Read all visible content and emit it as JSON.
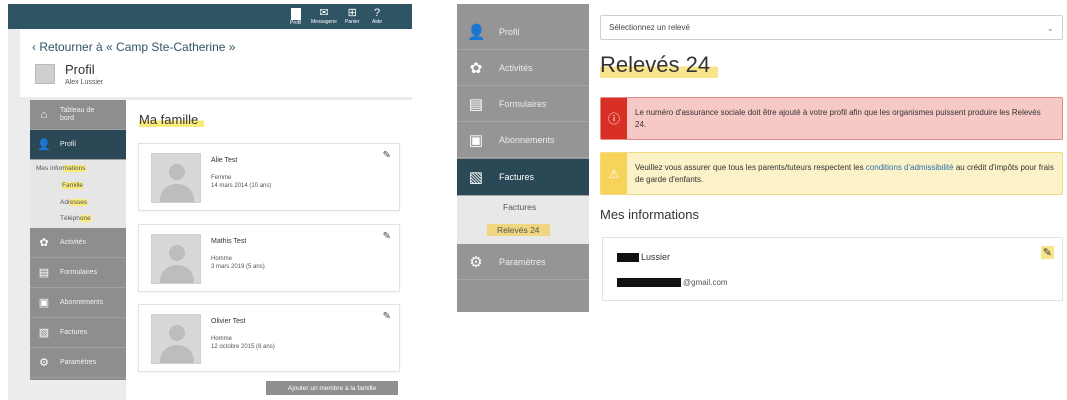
{
  "left": {
    "topbar": {
      "items": [
        {
          "label": "Profil",
          "icon": "profile-icon"
        },
        {
          "label": "Messagerie",
          "icon": "mail-icon"
        },
        {
          "label": "Panier",
          "icon": "cart-icon"
        },
        {
          "label": "Aide",
          "icon": "help-icon"
        }
      ]
    },
    "back_link": "‹  Retourner à « Camp Ste-Catherine »",
    "profile": {
      "title": "Profil",
      "name": "Alex Lussier"
    },
    "sidebar": {
      "items": [
        {
          "label": "Tableau de bord",
          "icon": "home-icon"
        },
        {
          "label": "Profil",
          "icon": "person-icon"
        },
        {
          "label": "Activités",
          "icon": "activities-icon"
        },
        {
          "label": "Formulaires",
          "icon": "forms-icon"
        },
        {
          "label": "Abonnements",
          "icon": "card-icon"
        },
        {
          "label": "Factures",
          "icon": "invoice-icon"
        },
        {
          "label": "Paramètres",
          "icon": "settings-icon"
        }
      ],
      "submenu": {
        "mes_info_a": "Mes infor",
        "mes_info_b": "mations",
        "famille": "Famille",
        "adresse_a": "Adr",
        "adresse_b": "esses",
        "tel_a": "Téléph",
        "tel_b": "one"
      }
    },
    "main": {
      "title": "Ma famille",
      "members": [
        {
          "name": "Alie Test",
          "gender": "Femme",
          "dob": "14 mars 2014 (10 ans)"
        },
        {
          "name": "Mathis Test",
          "gender": "Homme",
          "dob": "3 mars 2019 (5 ans)"
        },
        {
          "name": "Olivier Test",
          "gender": "Homme",
          "dob": "12 octobre 2015 (8 ans)"
        }
      ],
      "add_button": "Ajouter un membre à la famille"
    }
  },
  "right": {
    "sidebar": {
      "items": [
        {
          "label": "Profil",
          "icon": "person-icon"
        },
        {
          "label": "Activités",
          "icon": "activities-icon"
        },
        {
          "label": "Formulaires",
          "icon": "forms-icon"
        },
        {
          "label": "Abonnements",
          "icon": "card-icon"
        },
        {
          "label": "Factures",
          "icon": "invoice-icon"
        },
        {
          "label": "Paramètres",
          "icon": "settings-icon"
        }
      ],
      "submenu": {
        "factures": "Factures",
        "releves": "Relevés 24"
      }
    },
    "select": {
      "value": "Sélectionnez un relevé"
    },
    "title": "Relevés 24",
    "alert_red": {
      "text": "Le numéro d'assurance sociale doit être ajouté à votre profil afin que les organismes puissent produire les Relevés 24."
    },
    "alert_yellow": {
      "text_before": "Veuillez vous assurer que tous les parents/tuteurs respectent les ",
      "link": "conditions d'admissibilité",
      "text_after": " au crédit d'impôts pour frais de garde d'enfants."
    },
    "mes_informations": "Mes informations",
    "info": {
      "name": "Lussier",
      "email_suffix": "@gmail.com"
    }
  }
}
